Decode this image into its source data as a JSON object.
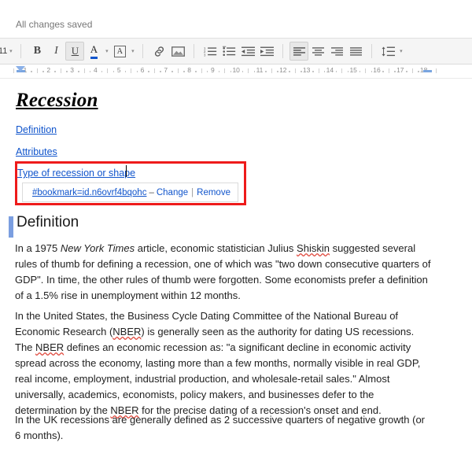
{
  "status": {
    "text": "All changes saved"
  },
  "toolbar": {
    "font_size": "11",
    "bold_label": "B",
    "italic_label": "I",
    "underline_label": "U",
    "text_color_label": "A",
    "highlight_label": "A",
    "insert_link_name": "link-icon",
    "insert_image_name": "image-icon",
    "numbered_list_name": "numbered-list-icon",
    "bulleted_list_name": "bulleted-list-icon",
    "decrease_indent_name": "decrease-indent-icon",
    "increase_indent_name": "increase-indent-icon",
    "align_left_name": "align-left-icon",
    "align_center_name": "align-center-icon",
    "align_right_name": "align-right-icon",
    "align_justify_name": "align-justify-icon",
    "line_spacing_name": "line-spacing-icon"
  },
  "ruler": {
    "numbers": [
      "1",
      "2",
      "3",
      "4",
      "5",
      "6",
      "7",
      "8",
      "9",
      "10",
      "11",
      "12",
      "13",
      "14",
      "15",
      "16",
      "17",
      "18"
    ],
    "left_indent_position": "0.5",
    "right_indent_position": "17"
  },
  "document": {
    "title": "Recession",
    "toc": [
      {
        "label": "Definition"
      },
      {
        "label": "Attributes"
      },
      {
        "label": "Type of recession or shape"
      }
    ],
    "link_bubble": {
      "url": "#bookmark=id.n6ovrf4bqohc",
      "dash": "–",
      "change_label": "Change",
      "separator": "|",
      "remove_label": "Remove"
    },
    "heading": "Definition",
    "paragraphs": {
      "p1_a": "In a 1975 ",
      "p1_italic": "New York Times",
      "p1_b": " article, economic statistician Julius ",
      "p1_misspelled": "Shiskin",
      "p1_c": " suggested several rules of thumb for defining a recession, one of which was \"two down consecutive quarters of GDP\". In time, the other rules of thumb were forgotten. Some economists prefer a definition of a 1.5% rise in unemployment within 12 months.",
      "p2_a": "In the United States, the Business Cycle Dating Committee of the National Bureau of Economic Research (",
      "p2_nber1": "NBER",
      "p2_b": ") is generally seen as the authority for dating US recessions. The ",
      "p2_nber2": "NBER",
      "p2_c": " defines an economic recession as: \"a significant decline in economic activity spread across the economy, lasting more than a few months, normally visible in real GDP, real income, employment, industrial production, and wholesale-retail sales.\" Almost universally, academics, economists, policy makers, and businesses defer to the determination by the ",
      "p2_nber3": "NBER",
      "p2_d": " for the precise dating of a recession's onset and end.",
      "p3": "In the UK recessions are generally defined as 2 successive quarters of negative growth (or 6 months)."
    }
  },
  "colors": {
    "link": "#1155cc",
    "annotation": "#ee1b1b",
    "heading_marker": "#7b9ee0",
    "spellcheck": "#e04a3f"
  }
}
